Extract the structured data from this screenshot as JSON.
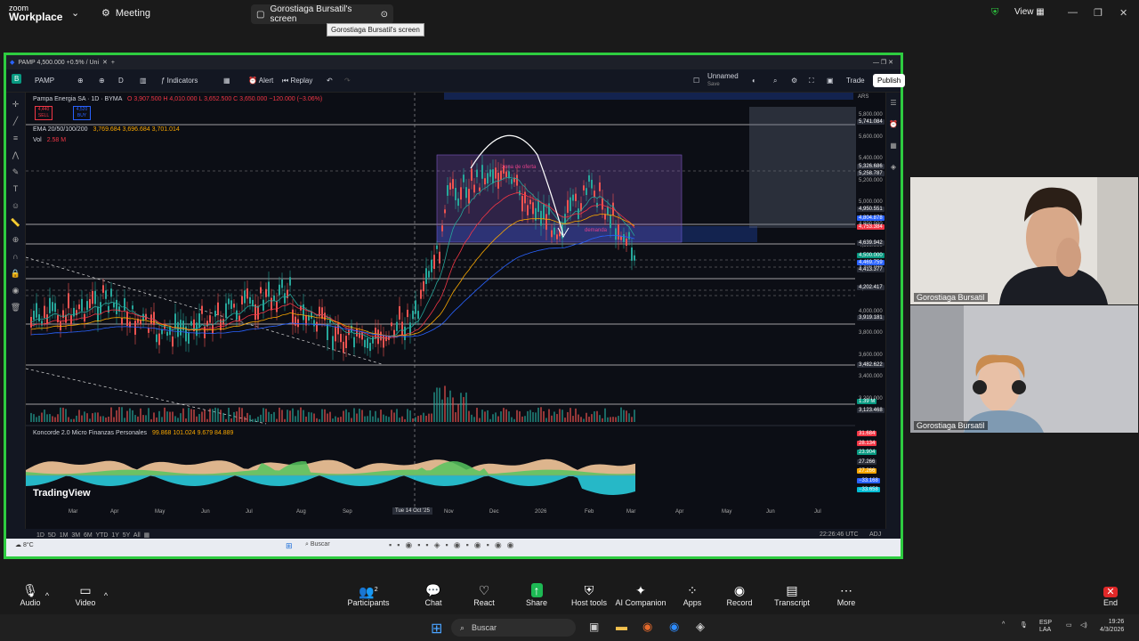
{
  "zoom": {
    "logo_line1": "zoom",
    "logo_line2": "Workplace",
    "meeting_label": "Meeting",
    "share_tab_label": "Gorostiaga Bursatil's screen",
    "tooltip": "Gorostiaga Bursatil's screen",
    "view_label": "View",
    "shield_color": "#2ecc40"
  },
  "browser": {
    "tab_title": "PAMP 4,500.000 +0.5% / Uni"
  },
  "tv": {
    "symbol": "PAMP",
    "interval": "D",
    "indicators_label": "Indicators",
    "alert_label": "Alert",
    "replay_label": "Replay",
    "layout_name": "Unnamed",
    "layout_sub": "Save",
    "trade_label": "Trade",
    "publish_label": "Publish",
    "legend_title": "Pampa Energia SA · 1D · BYMA",
    "legend_ohlc": "O 3,907.500 H 4,010.000 L 3,652.500 C 3,650.000 −120.000 (−3.06%)",
    "sell_price": "4,440",
    "sell_label": "SELL",
    "buy_price": "4,520",
    "buy_label": "BUY",
    "ema_label": "EMA 20/50/100/200",
    "ema_values": "3,769.684  3,696.684  3,701.014",
    "vol_label": "Vol",
    "vol_value": "2.58 M",
    "oscillator_label": "Koncorde 2.0 Micro Finanzas Personales",
    "oscillator_values": "99.868  101.024  9.679  84.889",
    "watermark": "TradingView",
    "demand_label": "demanda",
    "supply_label": "zona de oferta",
    "crosshair_date": "Tue 14 Oct '25",
    "currency": "ARS",
    "time_utc": "22:26:46 UTC",
    "adj": "ADJ",
    "x_labels": [
      "Mar",
      "Apr",
      "May",
      "Jun",
      "Jul",
      "Aug",
      "Sep",
      "Nov",
      "Dec",
      "2026",
      "Feb",
      "Mar",
      "Apr",
      "May",
      "Jun",
      "Jul"
    ],
    "periods": [
      "1D",
      "5D",
      "1M",
      "3M",
      "6M",
      "YTD",
      "1Y",
      "5Y",
      "All"
    ],
    "price_axis": [
      "5,800.000",
      "5,600.000",
      "5,400.000",
      "5,200.000",
      "5,000.000",
      "4,800.000",
      "4,600.000",
      "4,400.000",
      "4,200.000",
      "4,000.000",
      "3,800.000",
      "3,600.000",
      "3,400.000",
      "3,200.000"
    ],
    "price_tags": [
      {
        "text": "5,741.084",
        "color": "#2a2e39"
      },
      {
        "text": "5,326.686",
        "color": "#2a2e39"
      },
      {
        "text": "5,258.787",
        "color": "#2a2e39"
      },
      {
        "text": "4,950.551",
        "color": "#2a2e39"
      },
      {
        "text": "4,804.878",
        "color": "#2962ff"
      },
      {
        "text": "4,753.384",
        "color": "#f23645"
      },
      {
        "text": "4,639.942",
        "color": "#2a2e39"
      },
      {
        "text": "4,500.000",
        "color": "#089981"
      },
      {
        "text": "4,469.759",
        "color": "#2962ff"
      },
      {
        "text": "4,413.377",
        "color": "#2a2e39"
      },
      {
        "text": "4,202.417",
        "color": "#2a2e39"
      },
      {
        "text": "3,919.181",
        "color": "#2a2e39"
      },
      {
        "text": "3,482.622",
        "color": "#2a2e39"
      },
      {
        "text": "1.39 M",
        "color": "#089981"
      },
      {
        "text": "3,123.468",
        "color": "#2a2e39"
      }
    ],
    "osc_tags": [
      {
        "text": "31.684",
        "color": "#f23645"
      },
      {
        "text": "28.134",
        "color": "#f23645"
      },
      {
        "text": "23.904",
        "color": "#089981"
      },
      {
        "text": "27.266",
        "color": "#2a2e39"
      },
      {
        "text": "27.266",
        "color": "#f7a600"
      },
      {
        "text": "−33.168",
        "color": "#2962ff"
      },
      {
        "text": "−33.658",
        "color": "#00bcd4"
      }
    ]
  },
  "inner_taskbar": {
    "search_label": "Buscar",
    "weather": "8°C"
  },
  "participants": [
    {
      "name": "Gorostiaga Bursatil"
    },
    {
      "name": "Gorostiaga Bursatil"
    }
  ],
  "zoom_bottom": {
    "audio": "Audio",
    "video": "Video",
    "participants": "Participants",
    "participants_count": "2",
    "chat": "Chat",
    "react": "React",
    "share": "Share",
    "host_tools": "Host tools",
    "ai_companion": "AI Companion",
    "apps": "Apps",
    "record": "Record",
    "transcript": "Transcript",
    "more": "More",
    "end": "End"
  },
  "windows": {
    "search_label": "Buscar",
    "lang": "ESP",
    "lang2": "LAA",
    "time": "19:26",
    "date": "4/3/2026"
  }
}
